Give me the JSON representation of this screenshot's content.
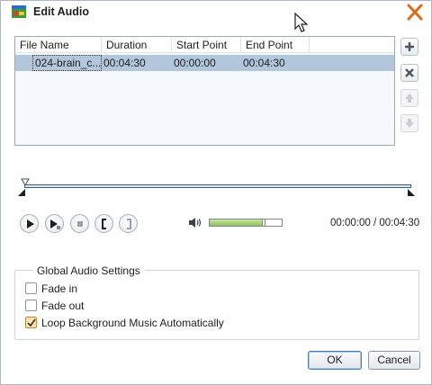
{
  "window": {
    "title": "Edit Audio",
    "icons": {
      "app": "app-audio-icon",
      "close": "close-icon"
    }
  },
  "audio_list": {
    "columns": [
      "File Name",
      "Duration",
      "Start Point",
      "End Point"
    ],
    "rows": [
      {
        "file_name": "024-brain_c...",
        "duration": "00:04:30",
        "start_point": "00:00:00",
        "end_point": "00:04:30",
        "selected": true
      }
    ]
  },
  "side_buttons": [
    {
      "icon": "add-icon",
      "enabled": true
    },
    {
      "icon": "remove-icon",
      "enabled": true
    },
    {
      "icon": "move-up-icon",
      "enabled": false
    },
    {
      "icon": "move-down-icon",
      "enabled": false
    }
  ],
  "playback": {
    "controls": [
      "play-icon",
      "play-selection-icon",
      "stop-icon",
      "mark-in-icon",
      "mark-out-icon"
    ],
    "volume_level": 0.75,
    "time_display": "00:00:00 / 00:04:30"
  },
  "global_audio_settings": {
    "title": "Global Audio Settings",
    "options": [
      {
        "label": "Fade in",
        "checked": false
      },
      {
        "label": "Fade out",
        "checked": false
      },
      {
        "label": "Loop Background Music Automatically",
        "checked": true
      }
    ]
  },
  "footer": {
    "ok_label": "OK",
    "cancel_label": "Cancel"
  },
  "colors": {
    "selection": "#b3c7dc",
    "close_x": "#e06a17",
    "track_border": "#355d85",
    "volume_fill": "#8fc25a",
    "checked_fill": "#fbe3b5"
  }
}
